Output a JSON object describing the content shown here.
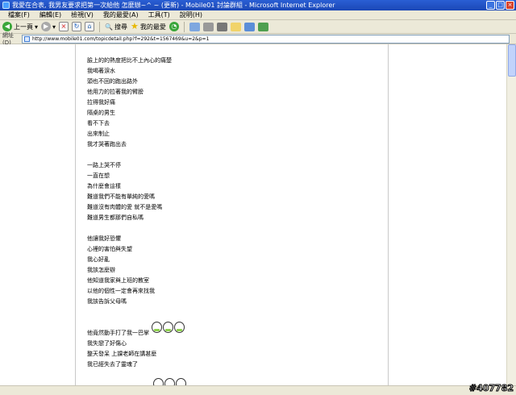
{
  "window": {
    "title": "我愛在合表, 我男友要求把第一次給他 怎麼辦~^ ~ (更新) - Mobile01 討論群組 - Microsoft Internet Explorer",
    "buttons": [
      "_",
      "□",
      "×"
    ]
  },
  "menubar": {
    "items": [
      "檔案(F)",
      "編輯(E)",
      "檢視(V)",
      "我的最愛(A)",
      "工具(T)",
      "說明(H)"
    ]
  },
  "toolbar": {
    "back_label": "上一頁",
    "search_label": "搜尋",
    "favorites_label": "我的最愛"
  },
  "addressbar": {
    "label": "網址(D)",
    "url": "http://www.mobile01.com/topicdetail.php?f=292&t=1567469&u=2&p=1"
  },
  "post": {
    "stanza1": [
      "臉上的的熱度把比不上內心的痛楚",
      "我喝著淚水",
      "頭也不回的跑出路外",
      "他用力的拉著我的臂膀",
      "拉得我好痛",
      "隔桌的男生",
      "看不下去",
      "出來制止",
      "我才哭著跑出去"
    ],
    "stanza2": [
      "一路上哭不停",
      "一直在想",
      "為什麼會這樣",
      "難道我們不能有單純的愛嗎",
      "難道沒有肉體的愛 就不是愛嗎",
      "難道男生都那們自私嗎"
    ],
    "stanza3": [
      "他讓我好恐懼",
      "心裡的害怕與失望",
      "我心好亂",
      "我該怎麼辦",
      "他知道我家與上班的教室",
      "以他的個性一定會再來找我",
      "我該告訴父母嗎"
    ],
    "stanza4": [
      "他竟然動手打了我一巴掌",
      "我失戀了好傷心",
      "整天發呆 上課老師在講甚麼",
      "我已經失去了靈魂了"
    ]
  },
  "watermark": "#407782"
}
